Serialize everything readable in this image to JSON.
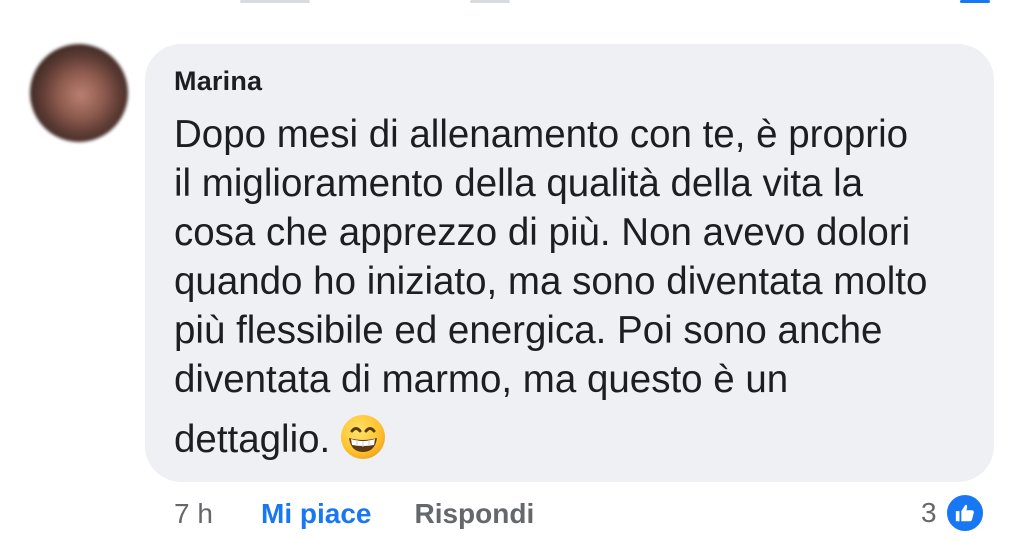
{
  "comment": {
    "author": "Marina",
    "lines": [
      "Dopo mesi di allenamento con te, è proprio",
      "il miglioramento della qualità della vita la",
      "cosa che apprezzo di più. Non avevo dolori",
      "quando ho iniziato, ma sono diventata molto",
      "più flessibile ed energica. Poi sono anche",
      "diventata di marmo, ma questo è un",
      "dettaglio."
    ],
    "emoji": "grinning-face-with-smiling-eyes",
    "avatar": "blurred-profile-photo"
  },
  "actions": {
    "timestamp": "7 h",
    "like_label": "Mi piace",
    "reply_label": "Rispondi"
  },
  "reactions": {
    "count": "3",
    "icon": "thumbs-up-icon"
  },
  "colors": {
    "bubble": "#eef0f3",
    "text": "#1c1e21",
    "muted": "#65676b",
    "accent": "#1877f2"
  }
}
